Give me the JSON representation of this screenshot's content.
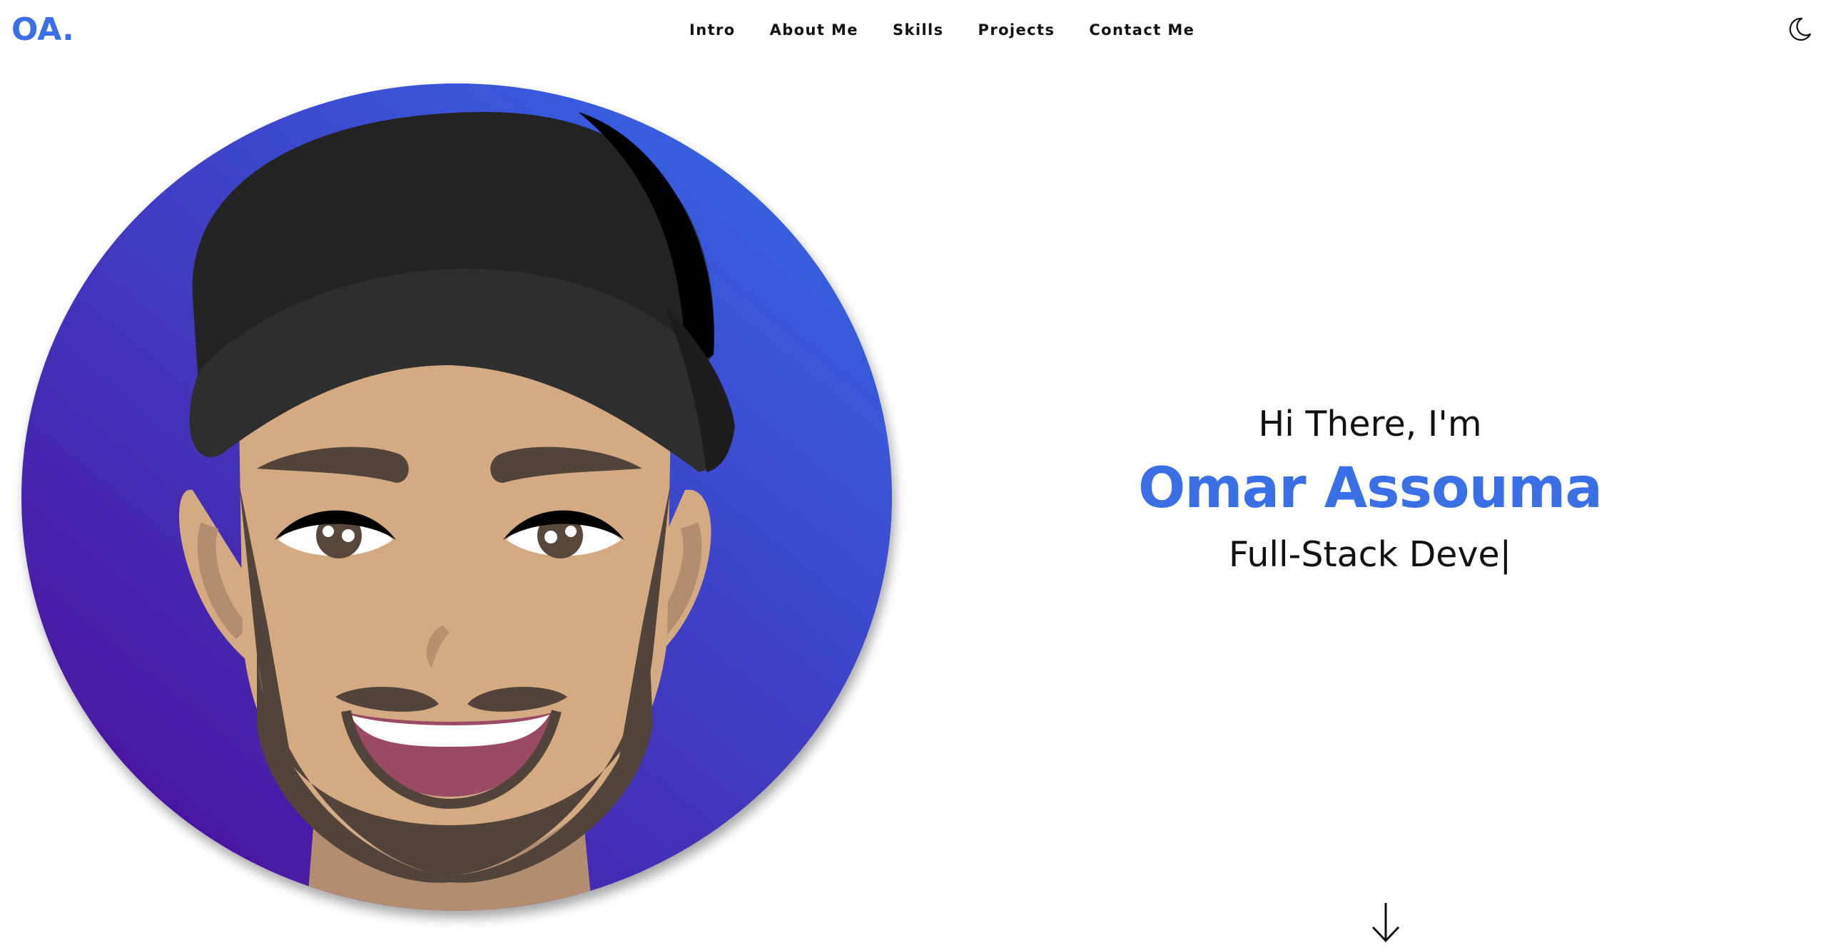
{
  "header": {
    "logo": "OA.",
    "nav": [
      {
        "label": "Intro"
      },
      {
        "label": "About Me"
      },
      {
        "label": "Skills"
      },
      {
        "label": "Projects"
      },
      {
        "label": "Contact Me"
      }
    ],
    "theme_icon": "moon-icon"
  },
  "hero": {
    "greeting": "Hi There, I'm",
    "name": "Omar Assouma",
    "role": "Full-Stack Deve",
    "cursor": "|"
  },
  "scroll_icon": "arrow-down-icon",
  "colors": {
    "accent": "#3b6fe6",
    "avatar_gradient_top": "#3a64e6",
    "avatar_gradient_bottom": "#4a1a9e",
    "cap": "#2b2b2b",
    "skin": "#d4aa82",
    "beard": "#52443a"
  }
}
